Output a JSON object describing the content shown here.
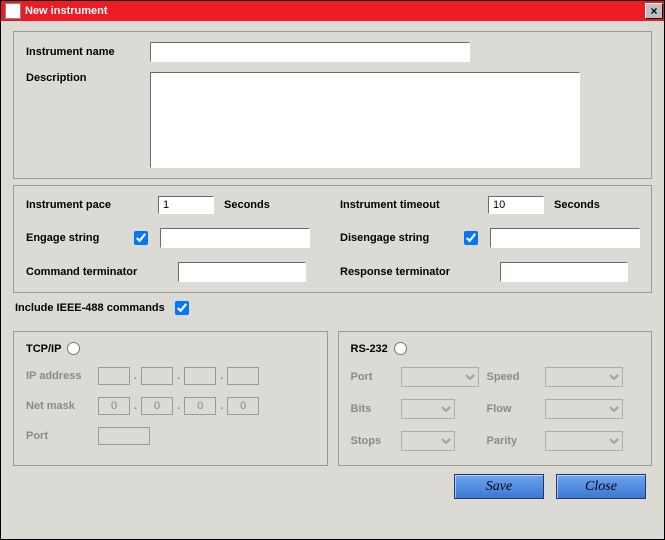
{
  "window": {
    "title": "New instrument",
    "close_glyph": "×"
  },
  "section1": {
    "name_label": "Instrument name",
    "name_value": "",
    "desc_label": "Description",
    "desc_value": ""
  },
  "section2": {
    "pace_label": "Instrument pace",
    "pace_value": "1",
    "pace_unit": "Seconds",
    "timeout_label": "Instrument timeout",
    "timeout_value": "10",
    "timeout_unit": "Seconds",
    "engage_label": "Engage string",
    "engage_checked": true,
    "engage_value": "",
    "disengage_label": "Disengage string",
    "disengage_checked": true,
    "disengage_value": "",
    "cmdterm_label": "Command terminator",
    "cmdterm_value": "",
    "respterm_label": "Response terminator",
    "respterm_value": ""
  },
  "ieee": {
    "label": "Include IEEE-488 commands",
    "checked": true
  },
  "tcpip": {
    "title": "TCP/IP",
    "selected": false,
    "ip_label": "IP address",
    "ip": [
      "",
      "",
      "",
      ""
    ],
    "mask_label": "Net mask",
    "mask": [
      "0",
      "0",
      "0",
      "0"
    ],
    "port_label": "Port",
    "port_value": ""
  },
  "rs232": {
    "title": "RS-232",
    "selected": false,
    "port_label": "Port",
    "port_value": "",
    "speed_label": "Speed",
    "speed_value": "",
    "bits_label": "Bits",
    "bits_value": "",
    "flow_label": "Flow",
    "flow_value": "",
    "stops_label": "Stops",
    "stops_value": "",
    "parity_label": "Parity",
    "parity_value": ""
  },
  "footer": {
    "save": "Save",
    "close": "Close"
  }
}
